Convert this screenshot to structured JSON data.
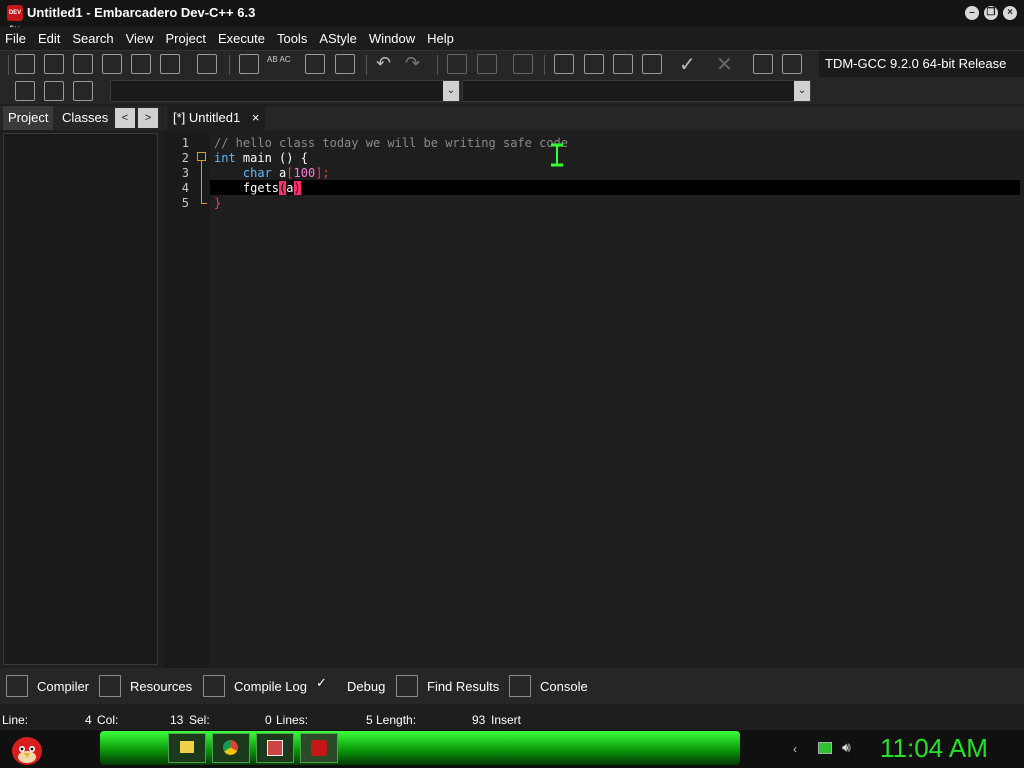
{
  "window": {
    "title": "Untitled1 - Embarcadero Dev-C++ 6.3",
    "app_icon_text": "DEV C++",
    "controls": [
      "minimize",
      "restore",
      "close"
    ]
  },
  "menu": [
    "File",
    "Edit",
    "Search",
    "View",
    "Project",
    "Execute",
    "Tools",
    "AStyle",
    "Window",
    "Help"
  ],
  "toolbar": {
    "compiler": "TDM-GCC 9.2.0 64-bit Release",
    "find_replace_text": "AB AC"
  },
  "left_panel": {
    "tabs": [
      "Project",
      "Classes"
    ],
    "nav_prev": "<",
    "nav_next": ">"
  },
  "editor": {
    "tab_label": "[*] Untitled1",
    "tab_close": "×",
    "line_numbers": [
      "1",
      "2",
      "3",
      "4",
      "5"
    ],
    "code": {
      "l1": "// hello class today we will be writing safe code",
      "l2_kw": "int",
      "l2_rest": " main () {",
      "l3_kw": "char",
      "l3_id": " a",
      "l3_open": "[",
      "l3_num": "100",
      "l3_close": "];",
      "l4_fn": "fgets",
      "l4_open": "(",
      "l4_arg": "a",
      "l4_close": ")",
      "l5": "}"
    },
    "current_line": 4
  },
  "bottom_tabs": [
    "Compiler",
    "Resources",
    "Compile Log",
    "Debug",
    "Find Results",
    "Console"
  ],
  "status": {
    "line_label": "Line:",
    "line_value": "4",
    "col_label": "Col:",
    "col_value": "13",
    "sel_label": "Sel:",
    "sel_value": "0",
    "lines_label": "Lines:",
    "lines_value": "5",
    "length_label": "Length:",
    "length_value": "93",
    "mode": "Insert"
  },
  "taskbar": {
    "clock": "11:04 AM",
    "accent_color": "#28e028",
    "apps": [
      "folder-icon",
      "chrome-icon",
      "media-icon",
      "devcpp-icon"
    ],
    "tray": [
      "arrow-icon",
      "network-icon",
      "speaker-icon"
    ]
  }
}
